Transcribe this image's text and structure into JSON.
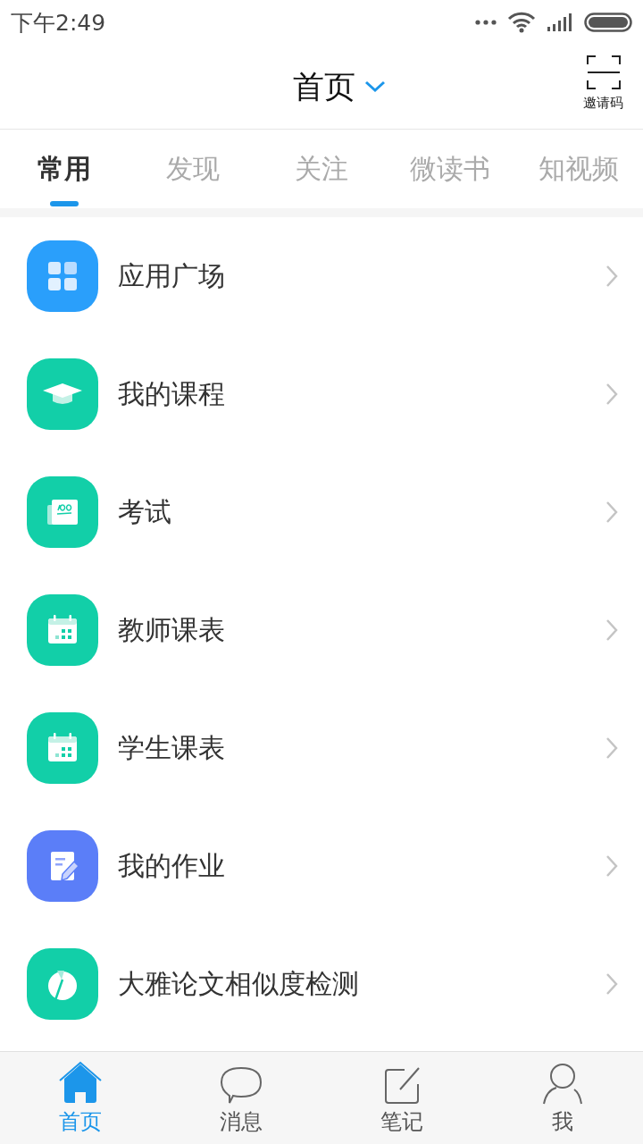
{
  "status_bar": {
    "time": "下午2:49"
  },
  "header": {
    "title": "首页",
    "scan_label": "邀请码"
  },
  "tabs": [
    {
      "label": "常用",
      "selected": true
    },
    {
      "label": "发现",
      "selected": false
    },
    {
      "label": "关注",
      "selected": false
    },
    {
      "label": "微读书",
      "selected": false
    },
    {
      "label": "知视频",
      "selected": false
    }
  ],
  "items": [
    {
      "label": "应用广场",
      "kind": "apps",
      "color": "#2a9ffb"
    },
    {
      "label": "我的课程",
      "kind": "course",
      "color": "#12cfa8"
    },
    {
      "label": "考试",
      "kind": "exam",
      "color": "#12cfa8"
    },
    {
      "label": "教师课表",
      "kind": "calendar",
      "color": "#12cfa8"
    },
    {
      "label": "学生课表",
      "kind": "calendar",
      "color": "#12cfa8"
    },
    {
      "label": "我的作业",
      "kind": "homework",
      "color": "#5b7ef8"
    },
    {
      "label": "大雅论文相似度检测",
      "kind": "report",
      "color": "#12cfa8"
    }
  ],
  "bottom_nav": [
    {
      "label": "首页",
      "kind": "home",
      "selected": true
    },
    {
      "label": "消息",
      "kind": "message",
      "selected": false
    },
    {
      "label": "笔记",
      "kind": "note",
      "selected": false
    },
    {
      "label": "我",
      "kind": "profile",
      "selected": false
    }
  ]
}
